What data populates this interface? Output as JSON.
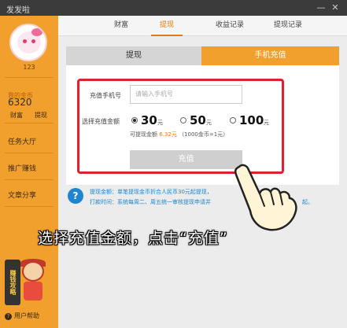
{
  "window": {
    "title": "发发啦",
    "minimize": "—",
    "close": "✕"
  },
  "sidebar": {
    "user_id": "123",
    "coin_label": "我的金币",
    "coin_value": "6320",
    "links": [
      "财富",
      "提现"
    ],
    "nav": [
      "任务大厅",
      "推广赚钱",
      "文章分享"
    ],
    "promo_text": "赚钱攻略",
    "help_label": "用户帮助"
  },
  "tabs": {
    "items": [
      "财富",
      "提现",
      "收益记录",
      "提现记录"
    ],
    "active_index": 1
  },
  "subtabs": {
    "left": "提现",
    "right": "手机充值",
    "active": "right"
  },
  "form": {
    "phone_label": "充值手机号",
    "phone_placeholder": "请输入手机号",
    "amount_label": "选择充值金额",
    "amounts": [
      {
        "value": "30",
        "unit": "元",
        "selected": true
      },
      {
        "value": "50",
        "unit": "元",
        "selected": false
      },
      {
        "value": "100",
        "unit": "元",
        "selected": false
      }
    ],
    "avail_prefix": "可提现金额",
    "avail_value": "6.32元",
    "avail_note": "（1000金币=1元）",
    "submit_label": "充值"
  },
  "notes": {
    "line1": "提现金额：单笔提现金币折合人民币30元起提现，",
    "line2": "打款时间：系统每周二、周五统一审核提现申请并",
    "line2_tail": "起。"
  },
  "caption": "选择充值金额，点击“充值”",
  "colors": {
    "accent": "#f2a02d",
    "highlight": "#d9232e",
    "info": "#1e86d1"
  }
}
